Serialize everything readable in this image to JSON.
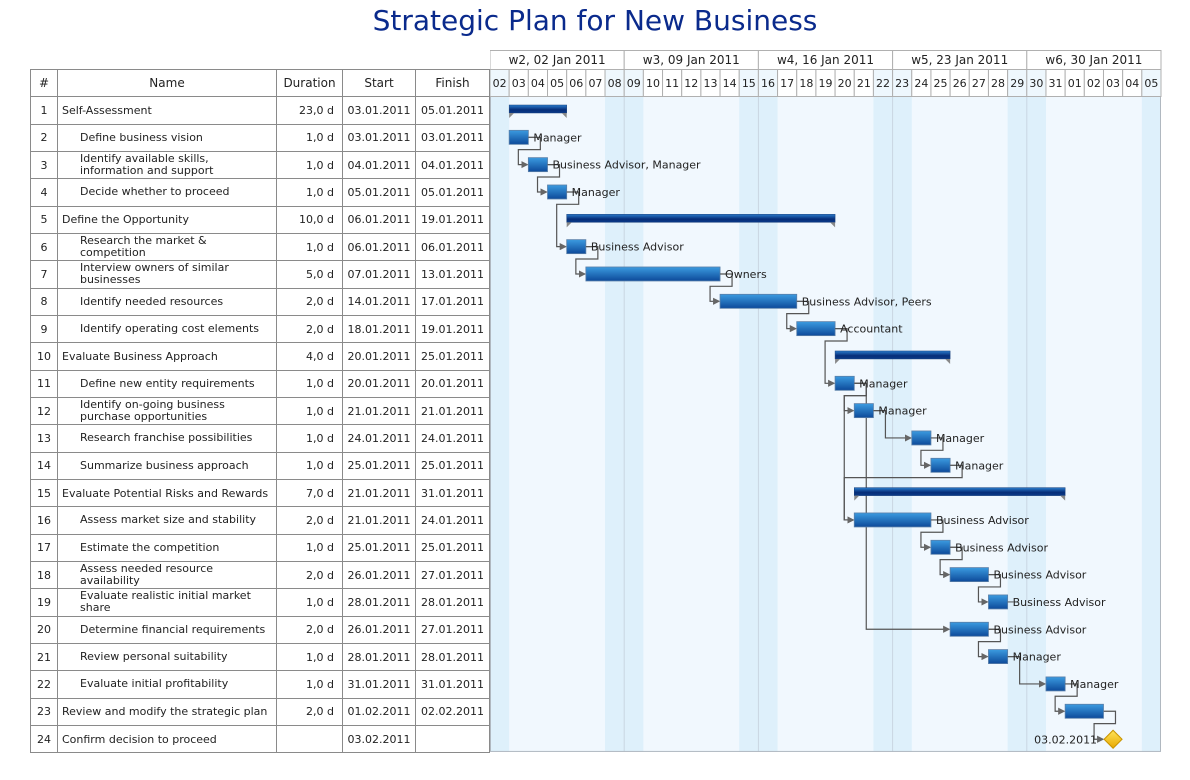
{
  "title": "Strategic Plan for New Business",
  "columns": {
    "num": "#",
    "name": "Name",
    "duration": "Duration",
    "start": "Start",
    "finish": "Finish"
  },
  "colors": {
    "title": "#0a2a8c",
    "bar_top": "#3b9be0",
    "bar_bottom": "#0d4a9a",
    "summary_top": "#1a6bc0",
    "summary_bottom": "#062d78",
    "weekend_bg": "#def0fb",
    "chart_bg": "#f1f8fe",
    "milestone": "#f7c600",
    "link": "#555555"
  },
  "chart_data": {
    "type": "gantt",
    "timeline_start": "2011-01-02",
    "timeline_days": 35,
    "weeks": [
      {
        "label": "w2, 02 Jan 2011",
        "days": 7
      },
      {
        "label": "w3, 09 Jan 2011",
        "days": 7
      },
      {
        "label": "w4, 16 Jan 2011",
        "days": 7
      },
      {
        "label": "w5, 23 Jan 2011",
        "days": 7
      },
      {
        "label": "w6, 30 Jan 2011",
        "days": 7
      }
    ],
    "day_labels": [
      "02",
      "03",
      "04",
      "05",
      "06",
      "07",
      "08",
      "09",
      "10",
      "11",
      "12",
      "13",
      "14",
      "15",
      "16",
      "17",
      "18",
      "19",
      "20",
      "21",
      "22",
      "23",
      "24",
      "25",
      "26",
      "27",
      "28",
      "29",
      "30",
      "31",
      "01",
      "02",
      "03",
      "04",
      "05"
    ],
    "weekend_day_indices": [
      0,
      6,
      7,
      13,
      14,
      20,
      21,
      27,
      28,
      34
    ],
    "tasks": [
      {
        "id": "1",
        "name": "Self-Assessment",
        "level": 0,
        "type": "summary",
        "duration": "23,0 d",
        "start": "03.01.2011",
        "finish": "05.01.2011",
        "resources": ""
      },
      {
        "id": "2",
        "name": "Define business vision",
        "level": 1,
        "type": "task",
        "duration": "1,0 d",
        "start": "03.01.2011",
        "finish": "03.01.2011",
        "resources": "Manager"
      },
      {
        "id": "3",
        "name": "Identify available skills, information and support",
        "level": 1,
        "type": "task",
        "duration": "1,0 d",
        "start": "04.01.2011",
        "finish": "04.01.2011",
        "resources": "Business Advisor, Manager"
      },
      {
        "id": "4",
        "name": "Decide whether to proceed",
        "level": 1,
        "type": "task",
        "duration": "1,0 d",
        "start": "05.01.2011",
        "finish": "05.01.2011",
        "resources": "Manager"
      },
      {
        "id": "5",
        "name": "Define the Opportunity",
        "level": 0,
        "type": "summary",
        "duration": "10,0 d",
        "start": "06.01.2011",
        "finish": "19.01.2011",
        "resources": ""
      },
      {
        "id": "6",
        "name": "Research the market & competition",
        "level": 1,
        "type": "task",
        "duration": "1,0 d",
        "start": "06.01.2011",
        "finish": "06.01.2011",
        "resources": "Business Advisor"
      },
      {
        "id": "7",
        "name": "Interview owners of similar businesses",
        "level": 1,
        "type": "task",
        "duration": "5,0 d",
        "start": "07.01.2011",
        "finish": "13.01.2011",
        "resources": "Owners"
      },
      {
        "id": "8",
        "name": "Identify needed resources",
        "level": 1,
        "type": "task",
        "duration": "2,0 d",
        "start": "14.01.2011",
        "finish": "17.01.2011",
        "resources": "Business Advisor, Peers"
      },
      {
        "id": "9",
        "name": "Identify operating cost elements",
        "level": 1,
        "type": "task",
        "duration": "2,0 d",
        "start": "18.01.2011",
        "finish": "19.01.2011",
        "resources": "Accountant"
      },
      {
        "id": "10",
        "name": "Evaluate Business Approach",
        "level": 0,
        "type": "summary",
        "duration": "4,0 d",
        "start": "20.01.2011",
        "finish": "25.01.2011",
        "resources": ""
      },
      {
        "id": "11",
        "name": "Define new entity requirements",
        "level": 1,
        "type": "task",
        "duration": "1,0 d",
        "start": "20.01.2011",
        "finish": "20.01.2011",
        "resources": "Manager"
      },
      {
        "id": "12",
        "name": "Identify on-going business purchase opportunities",
        "level": 1,
        "type": "task",
        "duration": "1,0 d",
        "start": "21.01.2011",
        "finish": "21.01.2011",
        "resources": "Manager"
      },
      {
        "id": "13",
        "name": "Research franchise possibilities",
        "level": 1,
        "type": "task",
        "duration": "1,0 d",
        "start": "24.01.2011",
        "finish": "24.01.2011",
        "resources": "Manager"
      },
      {
        "id": "14",
        "name": "Summarize business approach",
        "level": 1,
        "type": "task",
        "duration": "1,0 d",
        "start": "25.01.2011",
        "finish": "25.01.2011",
        "resources": "Manager"
      },
      {
        "id": "15",
        "name": "Evaluate Potential Risks and Rewards",
        "level": 0,
        "type": "summary",
        "duration": "7,0 d",
        "start": "21.01.2011",
        "finish": "31.01.2011",
        "resources": ""
      },
      {
        "id": "16",
        "name": "Assess market size and stability",
        "level": 1,
        "type": "task",
        "duration": "2,0 d",
        "start": "21.01.2011",
        "finish": "24.01.2011",
        "resources": "Business Advisor"
      },
      {
        "id": "17",
        "name": "Estimate the competition",
        "level": 1,
        "type": "task",
        "duration": "1,0 d",
        "start": "25.01.2011",
        "finish": "25.01.2011",
        "resources": "Business Advisor"
      },
      {
        "id": "18",
        "name": "Assess needed resource availability",
        "level": 1,
        "type": "task",
        "duration": "2,0 d",
        "start": "26.01.2011",
        "finish": "27.01.2011",
        "resources": "Business Advisor"
      },
      {
        "id": "19",
        "name": "Evaluate realistic initial market share",
        "level": 1,
        "type": "task",
        "duration": "1,0 d",
        "start": "28.01.2011",
        "finish": "28.01.2011",
        "resources": "Business Advisor"
      },
      {
        "id": "20",
        "name": "Determine financial requirements",
        "level": 1,
        "type": "task",
        "duration": "2,0 d",
        "start": "26.01.2011",
        "finish": "27.01.2011",
        "resources": "Business Advisor"
      },
      {
        "id": "21",
        "name": "Review personal suitability",
        "level": 1,
        "type": "task",
        "duration": "1,0 d",
        "start": "28.01.2011",
        "finish": "28.01.2011",
        "resources": "Manager"
      },
      {
        "id": "22",
        "name": "Evaluate initial profitability",
        "level": 1,
        "type": "task",
        "duration": "1,0 d",
        "start": "31.01.2011",
        "finish": "31.01.2011",
        "resources": "Manager"
      },
      {
        "id": "23",
        "name": "Review and modify the strategic plan",
        "level": 0,
        "type": "task",
        "duration": "2,0 d",
        "start": "01.02.2011",
        "finish": "02.02.2011",
        "resources": ""
      },
      {
        "id": "24",
        "name": "Confirm decision to proceed",
        "level": 0,
        "type": "milestone",
        "duration": "",
        "start": "03.02.2011",
        "finish": "",
        "resources": "",
        "milestone_label": "03.02.2011"
      }
    ],
    "links": [
      [
        "2",
        "3"
      ],
      [
        "3",
        "4"
      ],
      [
        "4",
        "6"
      ],
      [
        "6",
        "7"
      ],
      [
        "7",
        "8"
      ],
      [
        "8",
        "9"
      ],
      [
        "9",
        "11"
      ],
      [
        "11",
        "12"
      ],
      [
        "12",
        "13"
      ],
      [
        "13",
        "14"
      ],
      [
        "11",
        "16"
      ],
      [
        "14",
        "16"
      ],
      [
        "11",
        "20"
      ],
      [
        "16",
        "17"
      ],
      [
        "17",
        "18"
      ],
      [
        "18",
        "19"
      ],
      [
        "20",
        "21"
      ],
      [
        "21",
        "22"
      ],
      [
        "22",
        "23"
      ],
      [
        "23",
        "24"
      ]
    ]
  }
}
